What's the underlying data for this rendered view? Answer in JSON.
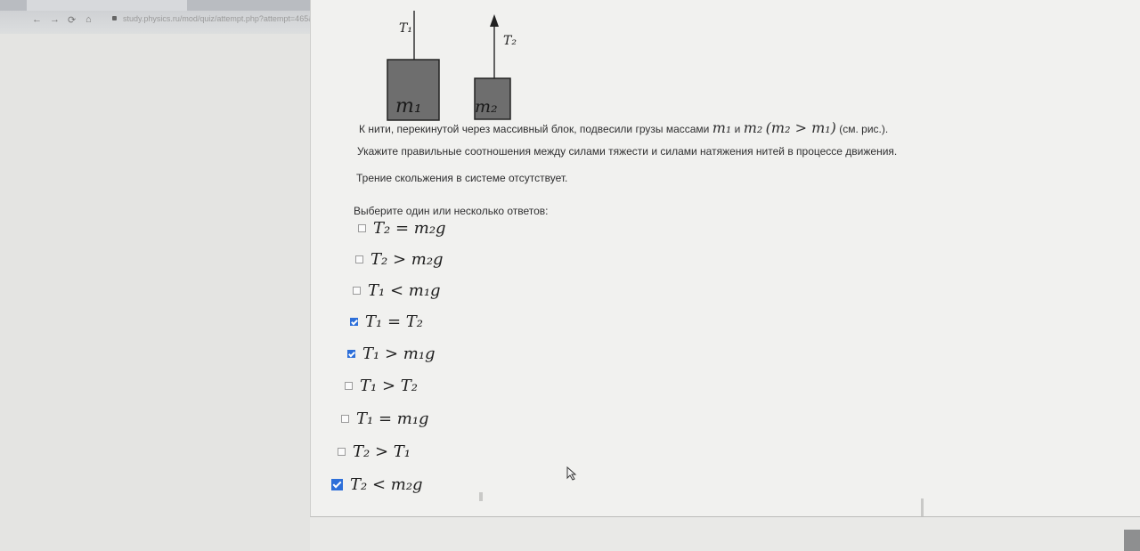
{
  "browser": {
    "url": "study.physics.ru/mod/quiz/attempt.php?attempt=465&cmid=1306&page=3",
    "nav": [
      "←",
      "→",
      "⟳",
      "⌂"
    ]
  },
  "figure": {
    "t1_label": "T₁",
    "t2_label": "T₂",
    "m1_label": "m₁",
    "m2_label": "m₂"
  },
  "question": {
    "line1_prefix": "К нити, перекинутой через массивный блок, подвесили грузы массами",
    "m1": "m₁",
    "and": "и",
    "m2": "m₂",
    "cond": "(m₂ > m₁)",
    "see_fig": "(см. рис.).",
    "line2": "Укажите правильные соотношения между силами тяжести и силами натяжения нитей в процессе движения.",
    "line3": "Трение скольжения в системе отсутствует.",
    "prompt": "Выберите один или несколько ответов:"
  },
  "options": [
    {
      "label": "T₂ = m₂g",
      "checked": false
    },
    {
      "label": "T₂ > m₂g",
      "checked": false
    },
    {
      "label": "T₁ < m₁g",
      "checked": false
    },
    {
      "label": "T₁ = T₂",
      "checked": true
    },
    {
      "label": "T₁ > m₁g",
      "checked": true
    },
    {
      "label": "T₁ > T₂",
      "checked": false
    },
    {
      "label": "T₁ = m₁g",
      "checked": false
    },
    {
      "label": "T₂ > T₁",
      "checked": false
    },
    {
      "label": "T₂ < m₂g",
      "checked": true
    }
  ],
  "colors": {
    "accent": "#2d6fd9",
    "block": "#6e6e6e"
  }
}
